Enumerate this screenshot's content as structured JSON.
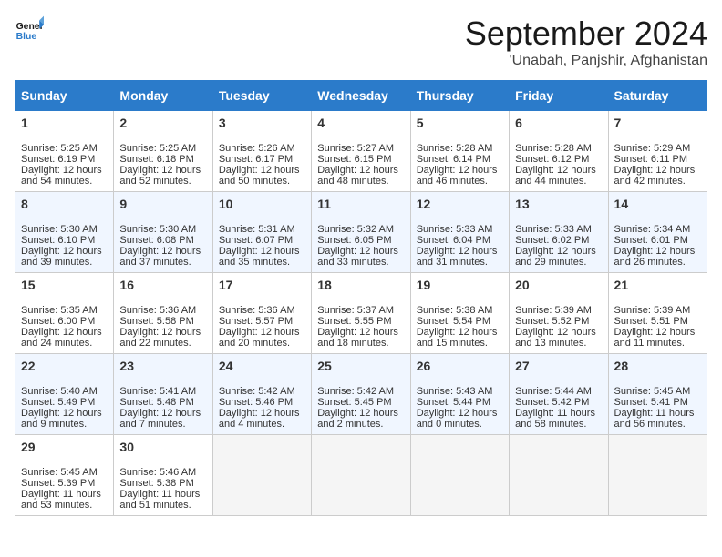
{
  "header": {
    "logo_general": "General",
    "logo_blue": "Blue",
    "month_title": "September 2024",
    "location": "'Unabah, Panjshir, Afghanistan"
  },
  "columns": [
    "Sunday",
    "Monday",
    "Tuesday",
    "Wednesday",
    "Thursday",
    "Friday",
    "Saturday"
  ],
  "weeks": [
    {
      "days": [
        {
          "date": "1",
          "sunrise": "Sunrise: 5:25 AM",
          "sunset": "Sunset: 6:19 PM",
          "daylight": "Daylight: 12 hours and 54 minutes."
        },
        {
          "date": "2",
          "sunrise": "Sunrise: 5:25 AM",
          "sunset": "Sunset: 6:18 PM",
          "daylight": "Daylight: 12 hours and 52 minutes."
        },
        {
          "date": "3",
          "sunrise": "Sunrise: 5:26 AM",
          "sunset": "Sunset: 6:17 PM",
          "daylight": "Daylight: 12 hours and 50 minutes."
        },
        {
          "date": "4",
          "sunrise": "Sunrise: 5:27 AM",
          "sunset": "Sunset: 6:15 PM",
          "daylight": "Daylight: 12 hours and 48 minutes."
        },
        {
          "date": "5",
          "sunrise": "Sunrise: 5:28 AM",
          "sunset": "Sunset: 6:14 PM",
          "daylight": "Daylight: 12 hours and 46 minutes."
        },
        {
          "date": "6",
          "sunrise": "Sunrise: 5:28 AM",
          "sunset": "Sunset: 6:12 PM",
          "daylight": "Daylight: 12 hours and 44 minutes."
        },
        {
          "date": "7",
          "sunrise": "Sunrise: 5:29 AM",
          "sunset": "Sunset: 6:11 PM",
          "daylight": "Daylight: 12 hours and 42 minutes."
        }
      ]
    },
    {
      "days": [
        {
          "date": "8",
          "sunrise": "Sunrise: 5:30 AM",
          "sunset": "Sunset: 6:10 PM",
          "daylight": "Daylight: 12 hours and 39 minutes."
        },
        {
          "date": "9",
          "sunrise": "Sunrise: 5:30 AM",
          "sunset": "Sunset: 6:08 PM",
          "daylight": "Daylight: 12 hours and 37 minutes."
        },
        {
          "date": "10",
          "sunrise": "Sunrise: 5:31 AM",
          "sunset": "Sunset: 6:07 PM",
          "daylight": "Daylight: 12 hours and 35 minutes."
        },
        {
          "date": "11",
          "sunrise": "Sunrise: 5:32 AM",
          "sunset": "Sunset: 6:05 PM",
          "daylight": "Daylight: 12 hours and 33 minutes."
        },
        {
          "date": "12",
          "sunrise": "Sunrise: 5:33 AM",
          "sunset": "Sunset: 6:04 PM",
          "daylight": "Daylight: 12 hours and 31 minutes."
        },
        {
          "date": "13",
          "sunrise": "Sunrise: 5:33 AM",
          "sunset": "Sunset: 6:02 PM",
          "daylight": "Daylight: 12 hours and 29 minutes."
        },
        {
          "date": "14",
          "sunrise": "Sunrise: 5:34 AM",
          "sunset": "Sunset: 6:01 PM",
          "daylight": "Daylight: 12 hours and 26 minutes."
        }
      ]
    },
    {
      "days": [
        {
          "date": "15",
          "sunrise": "Sunrise: 5:35 AM",
          "sunset": "Sunset: 6:00 PM",
          "daylight": "Daylight: 12 hours and 24 minutes."
        },
        {
          "date": "16",
          "sunrise": "Sunrise: 5:36 AM",
          "sunset": "Sunset: 5:58 PM",
          "daylight": "Daylight: 12 hours and 22 minutes."
        },
        {
          "date": "17",
          "sunrise": "Sunrise: 5:36 AM",
          "sunset": "Sunset: 5:57 PM",
          "daylight": "Daylight: 12 hours and 20 minutes."
        },
        {
          "date": "18",
          "sunrise": "Sunrise: 5:37 AM",
          "sunset": "Sunset: 5:55 PM",
          "daylight": "Daylight: 12 hours and 18 minutes."
        },
        {
          "date": "19",
          "sunrise": "Sunrise: 5:38 AM",
          "sunset": "Sunset: 5:54 PM",
          "daylight": "Daylight: 12 hours and 15 minutes."
        },
        {
          "date": "20",
          "sunrise": "Sunrise: 5:39 AM",
          "sunset": "Sunset: 5:52 PM",
          "daylight": "Daylight: 12 hours and 13 minutes."
        },
        {
          "date": "21",
          "sunrise": "Sunrise: 5:39 AM",
          "sunset": "Sunset: 5:51 PM",
          "daylight": "Daylight: 12 hours and 11 minutes."
        }
      ]
    },
    {
      "days": [
        {
          "date": "22",
          "sunrise": "Sunrise: 5:40 AM",
          "sunset": "Sunset: 5:49 PM",
          "daylight": "Daylight: 12 hours and 9 minutes."
        },
        {
          "date": "23",
          "sunrise": "Sunrise: 5:41 AM",
          "sunset": "Sunset: 5:48 PM",
          "daylight": "Daylight: 12 hours and 7 minutes."
        },
        {
          "date": "24",
          "sunrise": "Sunrise: 5:42 AM",
          "sunset": "Sunset: 5:46 PM",
          "daylight": "Daylight: 12 hours and 4 minutes."
        },
        {
          "date": "25",
          "sunrise": "Sunrise: 5:42 AM",
          "sunset": "Sunset: 5:45 PM",
          "daylight": "Daylight: 12 hours and 2 minutes."
        },
        {
          "date": "26",
          "sunrise": "Sunrise: 5:43 AM",
          "sunset": "Sunset: 5:44 PM",
          "daylight": "Daylight: 12 hours and 0 minutes."
        },
        {
          "date": "27",
          "sunrise": "Sunrise: 5:44 AM",
          "sunset": "Sunset: 5:42 PM",
          "daylight": "Daylight: 11 hours and 58 minutes."
        },
        {
          "date": "28",
          "sunrise": "Sunrise: 5:45 AM",
          "sunset": "Sunset: 5:41 PM",
          "daylight": "Daylight: 11 hours and 56 minutes."
        }
      ]
    },
    {
      "days": [
        {
          "date": "29",
          "sunrise": "Sunrise: 5:45 AM",
          "sunset": "Sunset: 5:39 PM",
          "daylight": "Daylight: 11 hours and 53 minutes."
        },
        {
          "date": "30",
          "sunrise": "Sunrise: 5:46 AM",
          "sunset": "Sunset: 5:38 PM",
          "daylight": "Daylight: 11 hours and 51 minutes."
        },
        null,
        null,
        null,
        null,
        null
      ]
    }
  ]
}
